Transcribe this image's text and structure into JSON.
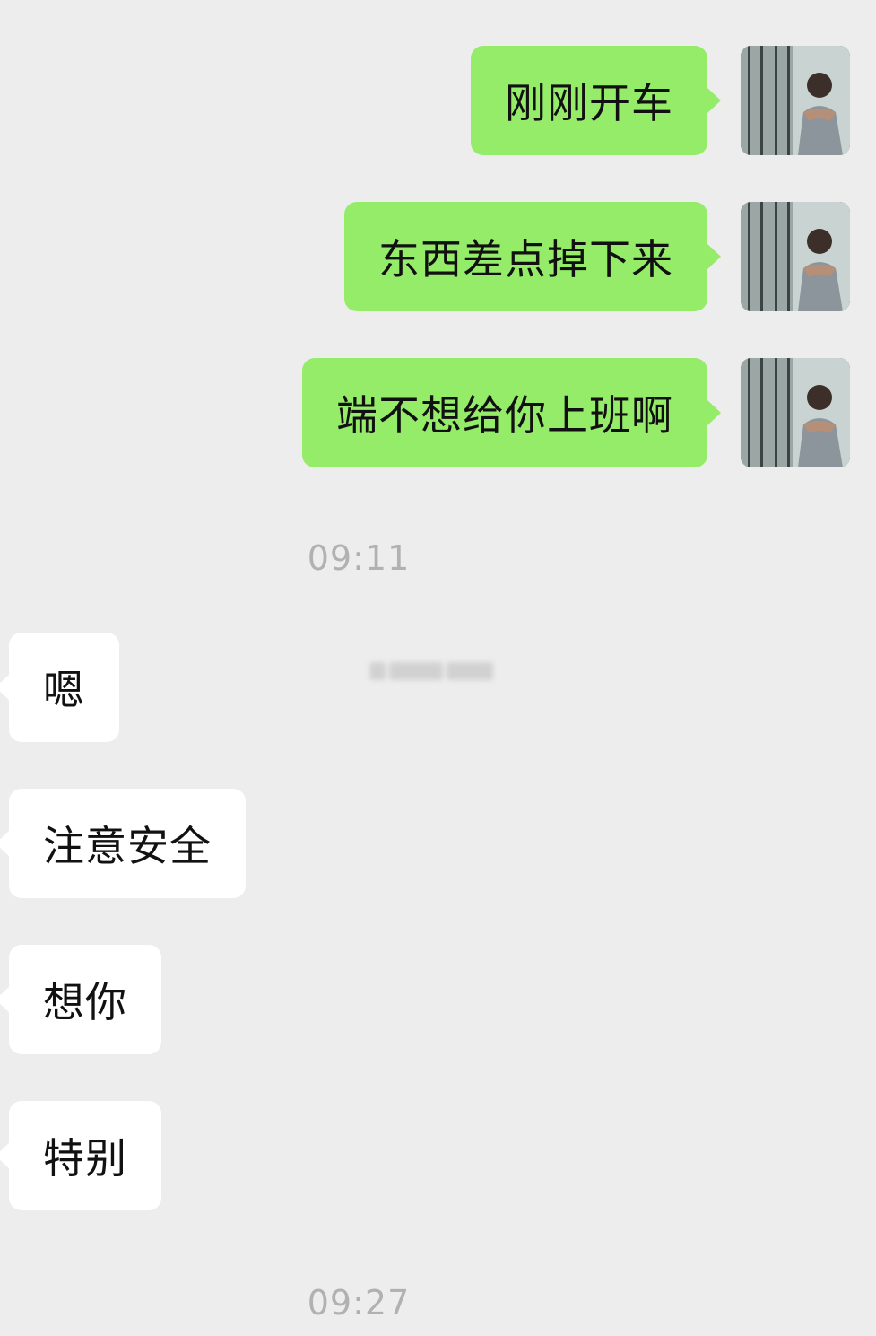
{
  "chat": {
    "sent_messages": [
      {
        "text": "刚刚开车"
      },
      {
        "text": "东西差点掉下来"
      },
      {
        "text": "端不想给你上班啊"
      }
    ],
    "timestamps": [
      "09:11",
      "09:27"
    ],
    "received_messages": [
      {
        "text": "嗯"
      },
      {
        "text": "注意安全"
      },
      {
        "text": "想你"
      },
      {
        "text": "特别"
      }
    ]
  },
  "colors": {
    "background": "#ededed",
    "sent_bubble": "#95ec69",
    "received_bubble": "#ffffff",
    "timestamp_text": "#b1b1b1"
  },
  "icons": {
    "self_avatar": "avatar-photo-icon"
  }
}
